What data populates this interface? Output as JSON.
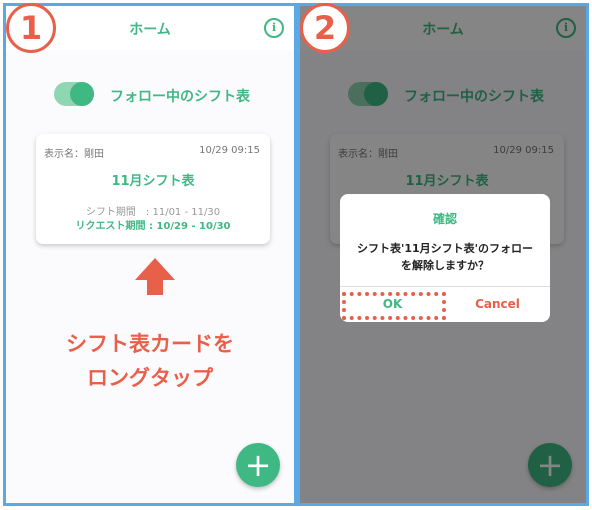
{
  "step1": {
    "badge": "1",
    "header": {
      "title": "ホーム"
    },
    "toggle": {
      "label": "フォロー中のシフト表",
      "on": true
    },
    "card": {
      "name_label": "表示名：剛田",
      "date": "10/29 09:15",
      "title": "11月シフト表",
      "shift_period": "シフト期間　: 11/01 - 11/30",
      "request_period": "リクエスト期間 : 10/29 - 10/30"
    },
    "instruction_line1": "シフト表カードを",
    "instruction_line2": "ロングタップ",
    "fab_label": "+"
  },
  "step2": {
    "badge": "2",
    "header": {
      "title": "ホーム"
    },
    "toggle": {
      "label": "フォロー中のシフト表",
      "on": true
    },
    "card": {
      "name_label": "表示名：剛田",
      "date": "10/29 09:15",
      "title": "11月シフト表"
    },
    "dialog": {
      "title": "確認",
      "message": "シフト表'11月シフト表'のフォローを解除しますか？",
      "ok_label": "OK",
      "cancel_label": "Cancel"
    },
    "fab_label": "+"
  },
  "colors": {
    "accent_green": "#3fb884",
    "annotation_red": "#e8604a",
    "frame_blue": "#5aa9e6"
  },
  "icons": [
    "menu-icon",
    "info-icon",
    "plus-icon",
    "arrow-up-icon"
  ]
}
